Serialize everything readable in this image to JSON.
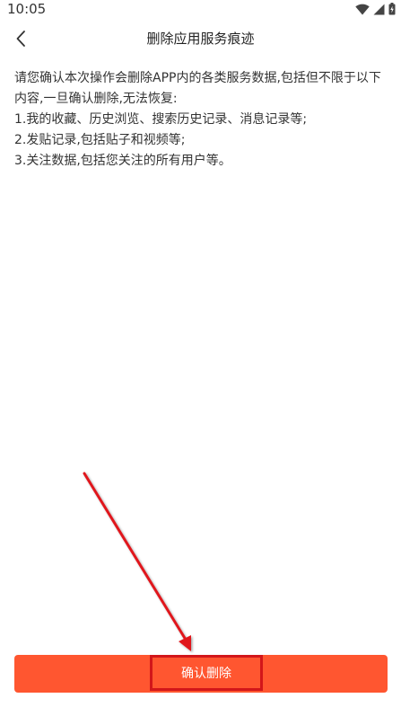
{
  "status_bar": {
    "time": "10:05",
    "icons": [
      "wifi-icon",
      "signal-icon",
      "battery-charging-icon"
    ]
  },
  "header": {
    "back_icon": "chevron-left-icon",
    "title": "删除应用服务痕迹"
  },
  "content": {
    "intro": "请您确认本次操作会删除APP内的各类服务数据,包括但不限于以下内容,一旦确认删除,无法恢复:",
    "items": [
      "1.我的收藏、历史浏览、搜索历史记录、消息记录等;",
      "2.发贴记录,包括贴子和视频等;",
      "3.关注数据,包括您关注的所有用户等。"
    ]
  },
  "footer": {
    "confirm_label": "确认删除"
  },
  "colors": {
    "accent": "#ff5630",
    "annotation": "#d2161a"
  }
}
